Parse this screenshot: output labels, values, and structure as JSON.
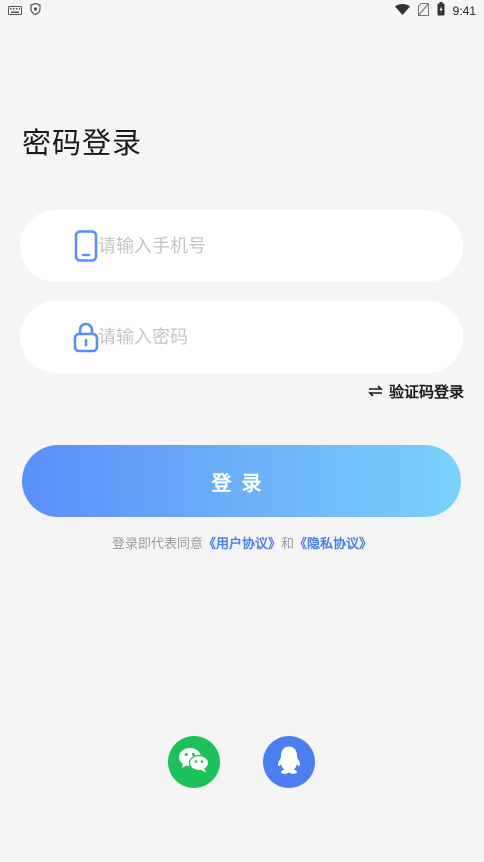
{
  "status_bar": {
    "time": "9:41"
  },
  "page": {
    "title": "密码登录"
  },
  "form": {
    "phone_placeholder": "请输入手机号",
    "password_placeholder": "请输入密码",
    "switch_label": "验证码登录",
    "login_label": "登录"
  },
  "agreement": {
    "prefix": "登录即代表同意",
    "user_agreement": "《用户协议》",
    "and": "和",
    "privacy_policy": "《隐私协议》"
  },
  "social": {
    "icons": [
      "wechat-icon",
      "qq-icon"
    ]
  },
  "colors": {
    "accent_blue": "#5b8ff7",
    "gradient_end": "#7ad2fb",
    "link": "#4a7fe8",
    "wechat_green": "#1ec05a",
    "qq_blue": "#4b7ef0",
    "background": "#f5f5f5"
  }
}
